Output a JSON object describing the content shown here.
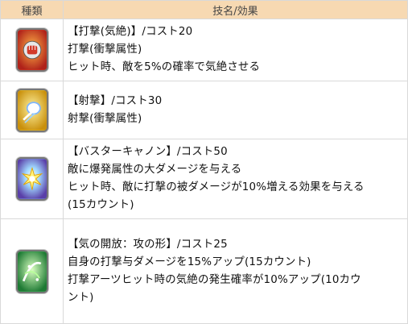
{
  "header": {
    "col_type": "種類",
    "col_skill": "技名/効果"
  },
  "rows": [
    {
      "icon": "fist-punch-card-icon",
      "card_color": "#d8402a",
      "lines": [
        "【打撃(気絶)】/コスト20",
        "打撃(衝撃属性)",
        "ヒット時、敵を5%の確率で気絶させる"
      ]
    },
    {
      "icon": "energy-shot-card-icon",
      "card_color": "#e6b51e",
      "lines": [
        "【射撃】/コスト30",
        "射撃(衝撃属性)"
      ]
    },
    {
      "icon": "buster-cannon-card-icon",
      "card_color": "#6e7bd6",
      "lines": [
        "【バスターキャノン】/コスト50",
        "敵に爆発属性の大ダメージを与える",
        "ヒット時、敵に打撃の被ダメージが10%増える効果を与える",
        "(15カウント)"
      ]
    },
    {
      "icon": "ki-release-card-icon",
      "card_color": "#2f9e4a",
      "lines": [
        "【気の開放：攻の形】/コスト25",
        "自身の打撃与ダメージを15%アップ(15カウント)",
        "打撃アーツヒット時の気絶の発生確率が10%アップ(10カウ",
        "ント)"
      ]
    }
  ]
}
